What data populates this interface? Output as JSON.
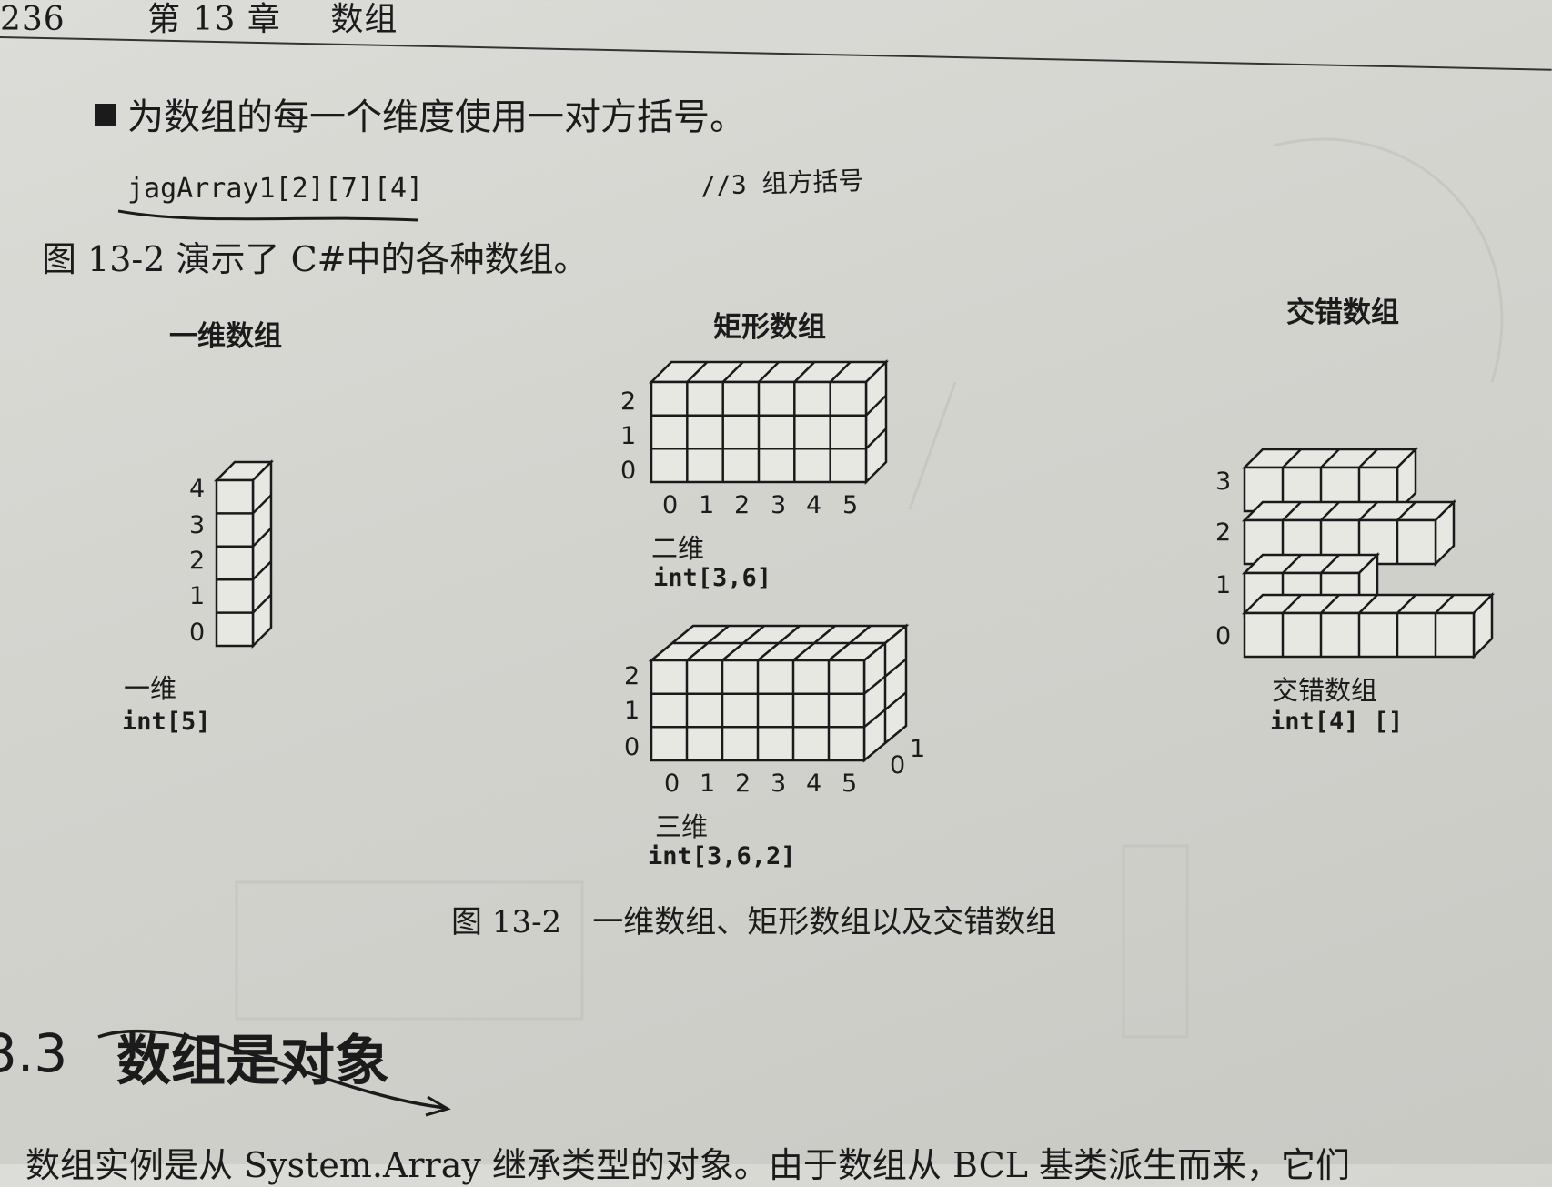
{
  "header": {
    "page_number": "236",
    "chapter": "第 13 章",
    "chapter_title": "数组"
  },
  "bullet": {
    "text": "为数组的每一个维度使用一对方括号。"
  },
  "code": {
    "text": "jagArray1[2][7][4]",
    "comment": "//3 组方括号"
  },
  "intro": {
    "text": "图 13-2 演示了 C#中的各种数组。"
  },
  "figure": {
    "one_dim": {
      "title": "一维数组",
      "ticks": [
        "4",
        "3",
        "2",
        "1",
        "0"
      ],
      "subtitle": "一维",
      "type": "int[5]"
    },
    "rect": {
      "title": "矩形数组",
      "two_dim": {
        "y_ticks": [
          "2",
          "1",
          "0"
        ],
        "x_ticks": [
          "0",
          "1",
          "2",
          "3",
          "4",
          "5"
        ],
        "subtitle": "二维",
        "type": "int[3,6]"
      },
      "three_dim": {
        "y_ticks": [
          "2",
          "1",
          "0"
        ],
        "x_ticks": [
          "0",
          "1",
          "2",
          "3",
          "4",
          "5"
        ],
        "z_ticks": [
          "0",
          "1"
        ],
        "subtitle": "三维",
        "type": "int[3,6,2]"
      }
    },
    "jagged": {
      "title": "交错数组",
      "ticks": [
        "3",
        "2",
        "1",
        "0"
      ],
      "row_lengths": [
        4,
        5,
        3,
        6
      ],
      "subtitle": "交错数组",
      "type": "int[4] []"
    },
    "caption": "图 13-2　一维数组、矩形数组以及交错数组"
  },
  "section": {
    "number": "3.3",
    "title": "数组是对象"
  },
  "footer": {
    "text": "数组实例是从 System.Array 继承类型的对象。由于数组从 BCL 基类派生而来，它们"
  }
}
